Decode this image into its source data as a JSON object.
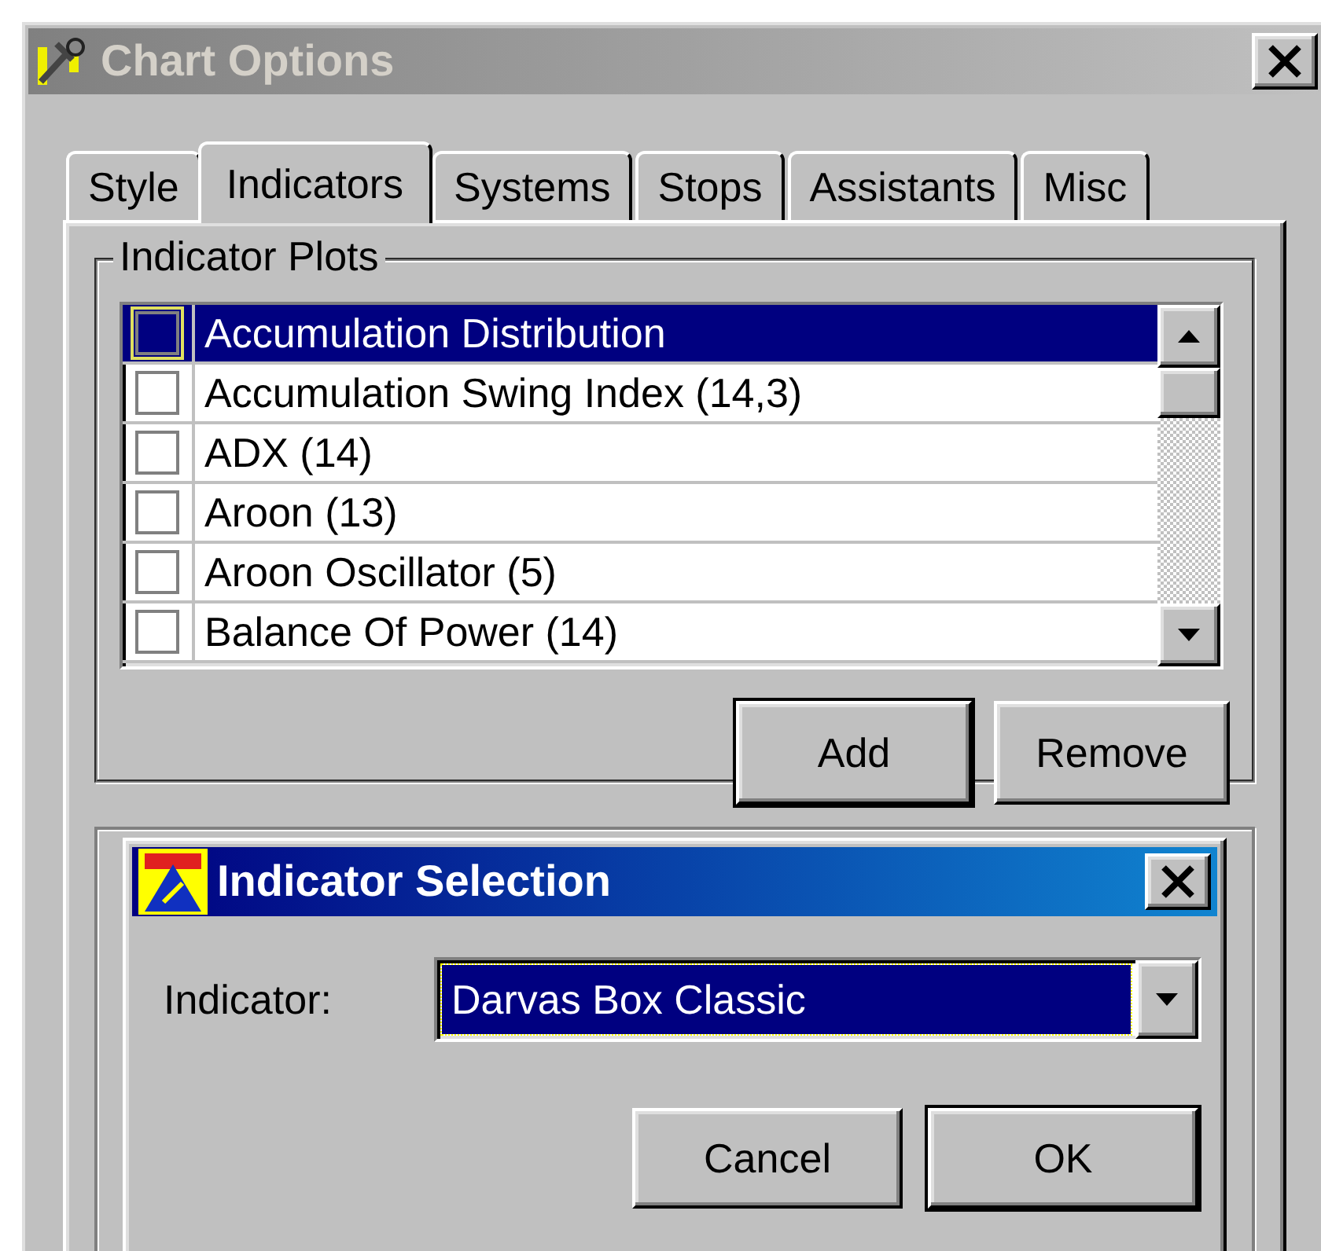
{
  "window": {
    "title": "Chart Options"
  },
  "tabs": [
    {
      "label": "Style",
      "selected": false
    },
    {
      "label": "Indicators",
      "selected": true
    },
    {
      "label": "Systems",
      "selected": false
    },
    {
      "label": "Stops",
      "selected": false
    },
    {
      "label": "Assistants",
      "selected": false
    },
    {
      "label": "Misc",
      "selected": false
    }
  ],
  "indicator_plots": {
    "title": "Indicator Plots",
    "items": [
      {
        "label": "Accumulation Distribution",
        "checked": false,
        "selected": true
      },
      {
        "label": "Accumulation Swing Index (14,3)",
        "checked": false,
        "selected": false
      },
      {
        "label": "ADX (14)",
        "checked": false,
        "selected": false
      },
      {
        "label": "Aroon (13)",
        "checked": false,
        "selected": false
      },
      {
        "label": "Aroon Oscillator (5)",
        "checked": false,
        "selected": false
      },
      {
        "label": "Balance Of Power (14)",
        "checked": false,
        "selected": false
      }
    ],
    "buttons": [
      {
        "label": "Add",
        "default": true
      },
      {
        "label": "Remove",
        "default": false
      }
    ]
  },
  "dialog": {
    "title": "Indicator Selection",
    "field_label": "Indicator:",
    "value": "Darvas Box Classic",
    "buttons": [
      {
        "label": "Cancel",
        "default": false
      },
      {
        "label": "OK",
        "default": true
      }
    ]
  }
}
